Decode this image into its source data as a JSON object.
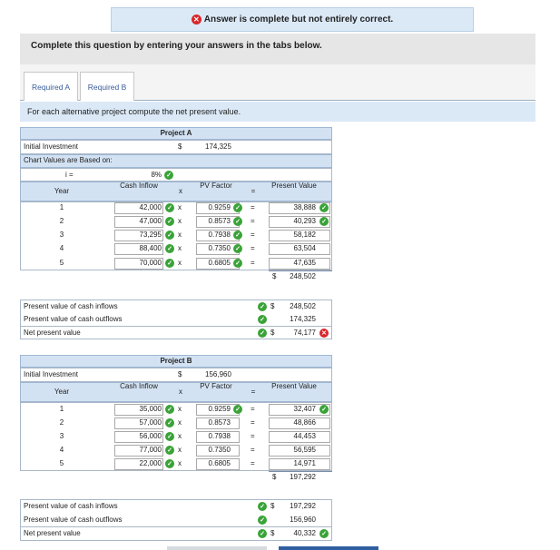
{
  "banner": {
    "text": "Answer is complete but not entirely correct."
  },
  "instructions": "Complete this question by entering your answers in the tabs below.",
  "tabs": [
    {
      "label": "Required A"
    },
    {
      "label": "Required B"
    }
  ],
  "prompt": "For each alternative project compute the net present value.",
  "project_a": {
    "title": "Project A",
    "initial_investment_label": "Initial Investment",
    "initial_investment_currency": "$",
    "initial_investment_value": "174,325",
    "chart_values_label": "Chart Values are Based on:",
    "i_label": "i =",
    "rate": "8%",
    "headers": {
      "year": "Year",
      "cash_inflow": "Cash Inflow",
      "x": "x",
      "pv_factor": "PV Factor",
      "eq": "=",
      "present_value": "Present Value"
    },
    "rows": [
      {
        "year": "1",
        "cash": "42,000",
        "factor": "0.9259",
        "pv": "38,888"
      },
      {
        "year": "2",
        "cash": "47,000",
        "factor": "0.8573",
        "pv": "40,293"
      },
      {
        "year": "3",
        "cash": "73,295",
        "factor": "0.7938",
        "pv": "58,182"
      },
      {
        "year": "4",
        "cash": "88,400",
        "factor": "0.7350",
        "pv": "63,504"
      },
      {
        "year": "5",
        "cash": "70,000",
        "factor": "0.6805",
        "pv": "47,635"
      }
    ],
    "total_currency": "$",
    "total": "248,502",
    "summary": [
      {
        "label": "Present value of cash inflows",
        "currency": "$",
        "value": "248,502"
      },
      {
        "label": "Present value of cash outflows",
        "currency": "",
        "value": "174,325"
      },
      {
        "label": "Net present value",
        "currency": "$",
        "value": "74,177"
      }
    ]
  },
  "project_b": {
    "title": "Project B",
    "initial_investment_label": "Initial Investment",
    "initial_investment_currency": "$",
    "initial_investment_value": "156,960",
    "headers": {
      "year": "Year",
      "cash_inflow": "Cash Inflow",
      "x": "x",
      "pv_factor": "PV Factor",
      "eq": "=",
      "present_value": "Present Value"
    },
    "rows": [
      {
        "year": "1",
        "cash": "35,000",
        "factor": "0.9259",
        "pv": "32,407"
      },
      {
        "year": "2",
        "cash": "57,000",
        "factor": "0.8573",
        "pv": "48,866"
      },
      {
        "year": "3",
        "cash": "56,000",
        "factor": "0.7938",
        "pv": "44,453"
      },
      {
        "year": "4",
        "cash": "77,000",
        "factor": "0.7350",
        "pv": "56,595"
      },
      {
        "year": "5",
        "cash": "22,000",
        "factor": "0.6805",
        "pv": "14,971"
      }
    ],
    "total_currency": "$",
    "total": "197,292",
    "summary": [
      {
        "label": "Present value of cash inflows",
        "currency": "$",
        "value": "197,292"
      },
      {
        "label": "Present value of cash outflows",
        "currency": "",
        "value": "156,960"
      },
      {
        "label": "Net present value",
        "currency": "$",
        "value": "40,332"
      }
    ]
  },
  "status": {
    "correct": "✓",
    "incorrect": "✕"
  }
}
